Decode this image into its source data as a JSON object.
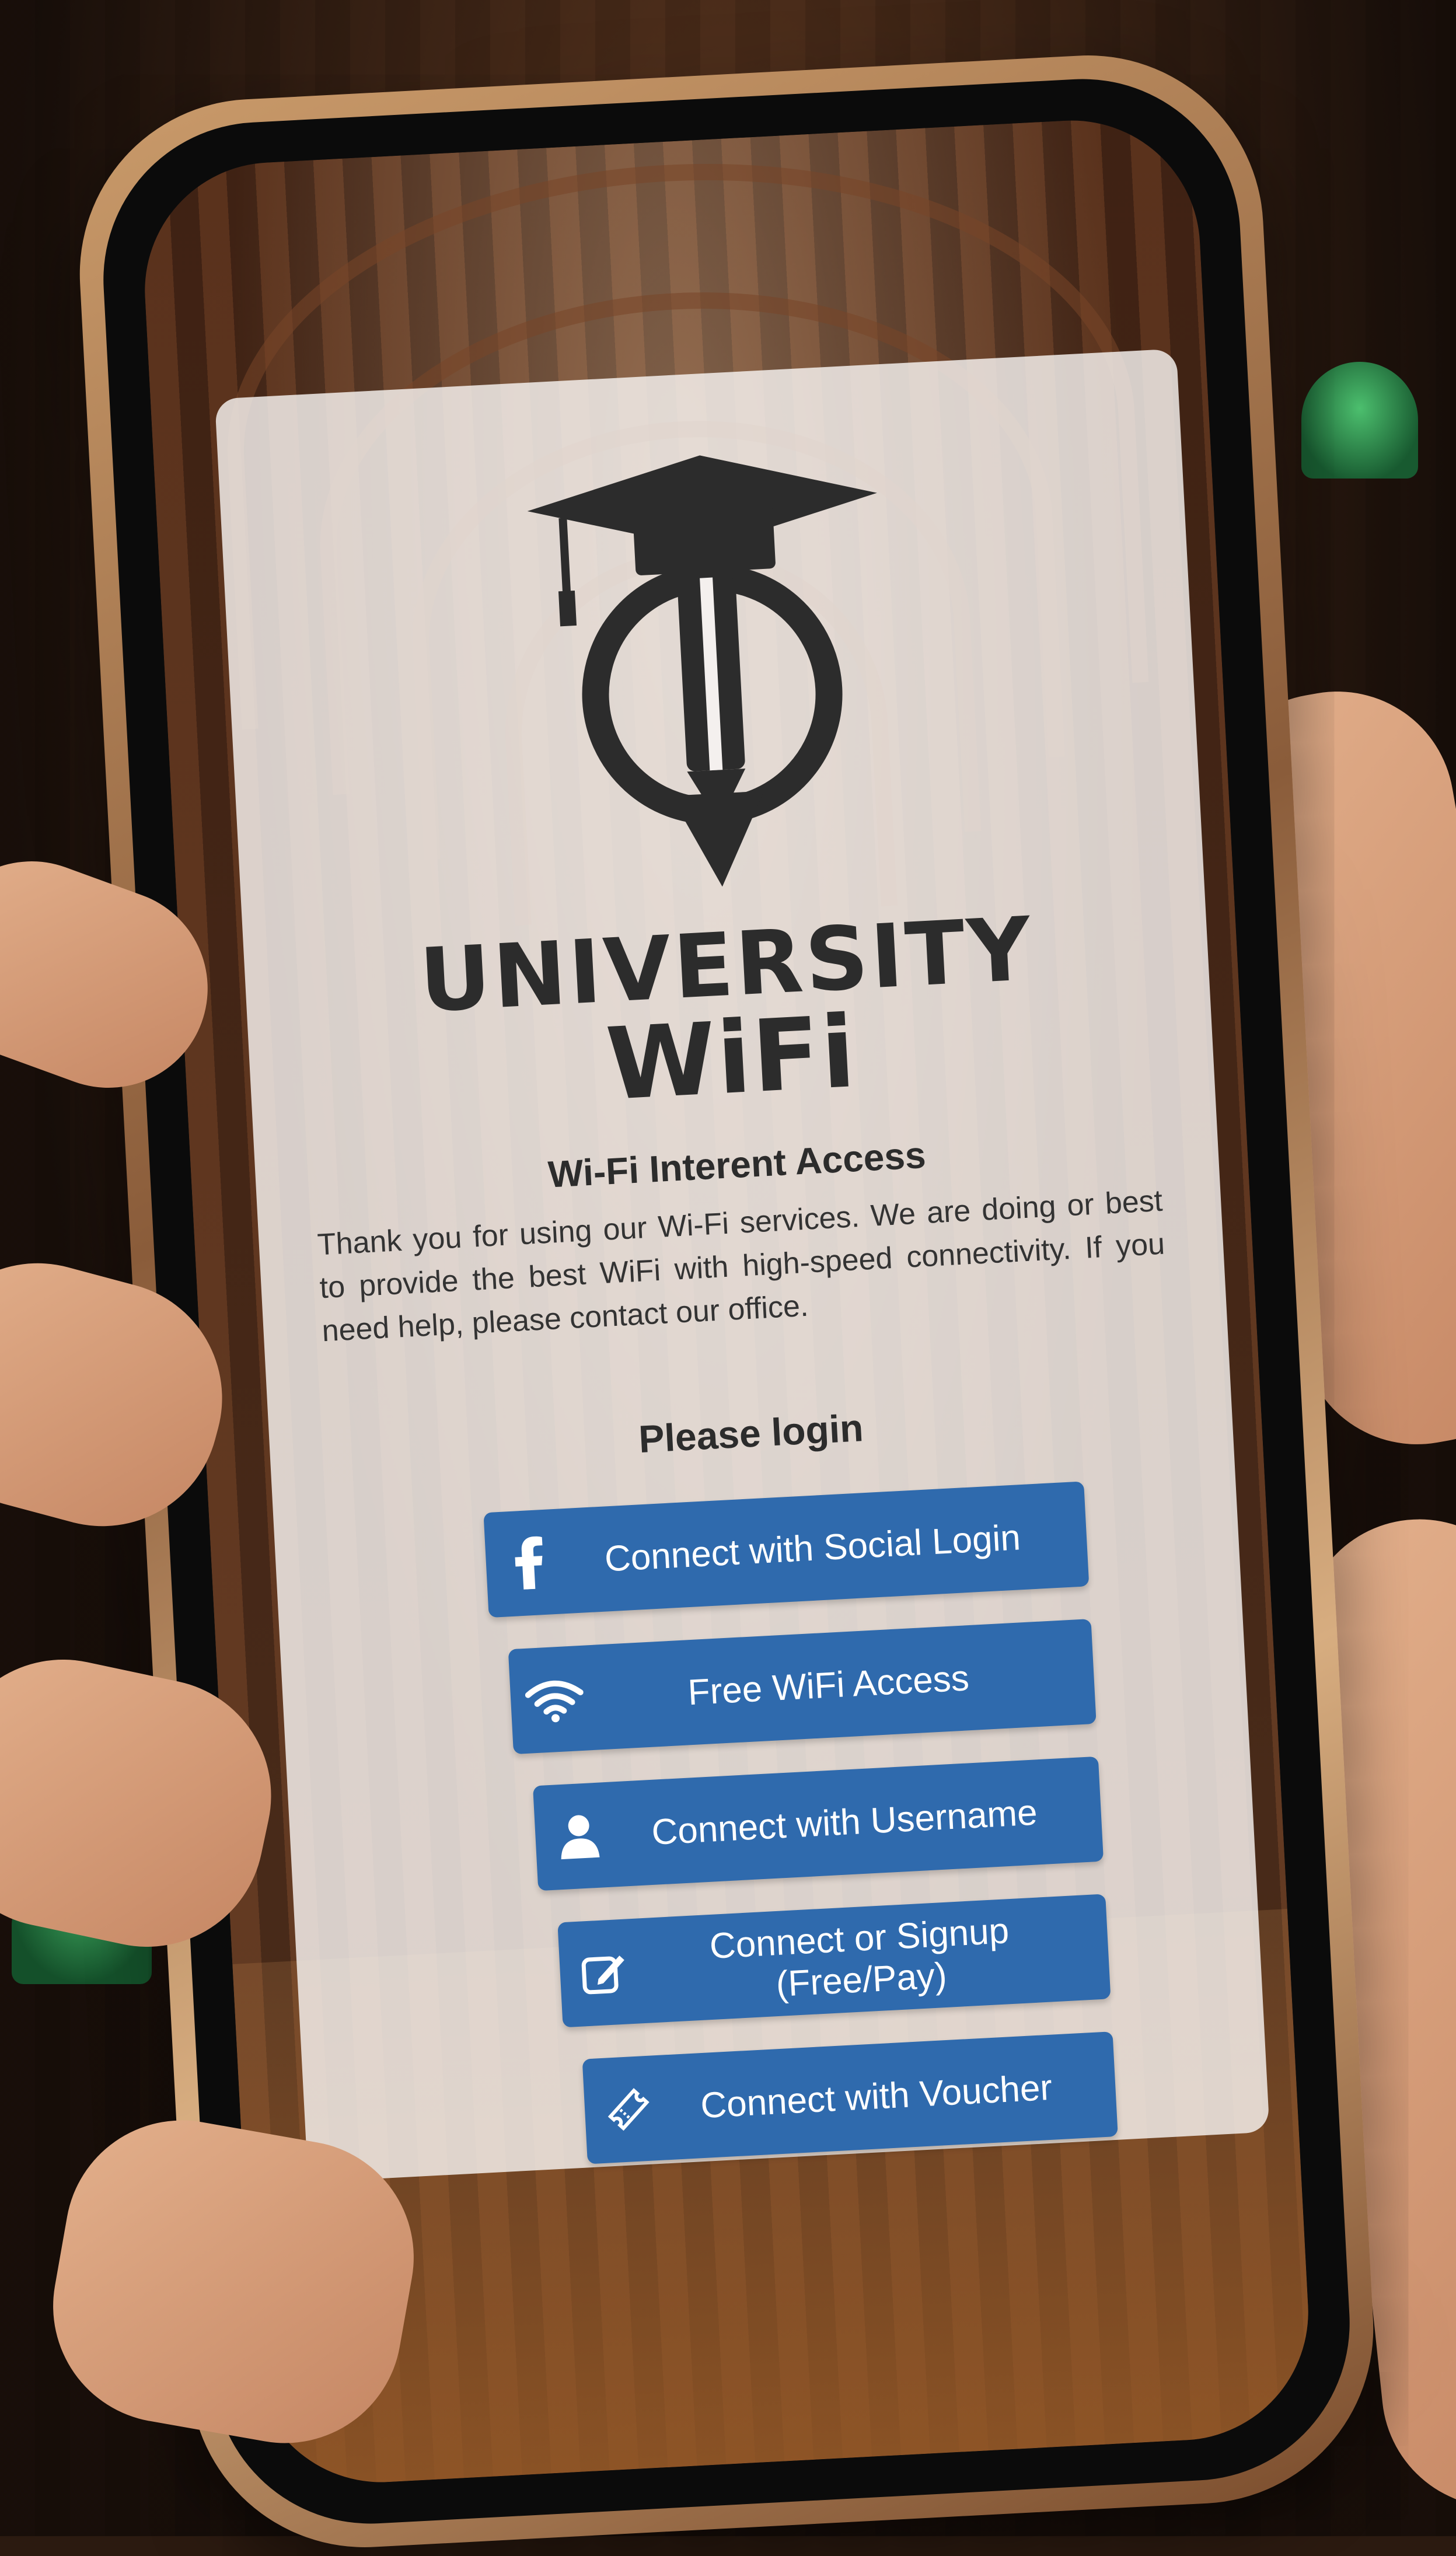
{
  "logo": {
    "line1": "UNIVERSITY",
    "line2": "WiFi"
  },
  "content": {
    "title": "Wi-Fi Interent Access",
    "description": "Thank you for using our Wi-Fi services. We are doing or best to provide the best WiFi with high-speed connectivity. If you need help, please contact our office.",
    "login_label": "Please login"
  },
  "buttons": [
    {
      "label": "Connect with Social Login",
      "icon": "facebook-icon"
    },
    {
      "label": "Free WiFi Access",
      "icon": "wifi-icon"
    },
    {
      "label": "Connect with Username",
      "icon": "user-icon"
    },
    {
      "label": "Connect or Signup (Free/Pay)",
      "icon": "edit-icon"
    },
    {
      "label": "Connect with Voucher",
      "icon": "ticket-icon"
    }
  ],
  "colors": {
    "button": "#2f6aad",
    "text_dark": "#2c2c2c",
    "card": "#f8f4f2"
  }
}
